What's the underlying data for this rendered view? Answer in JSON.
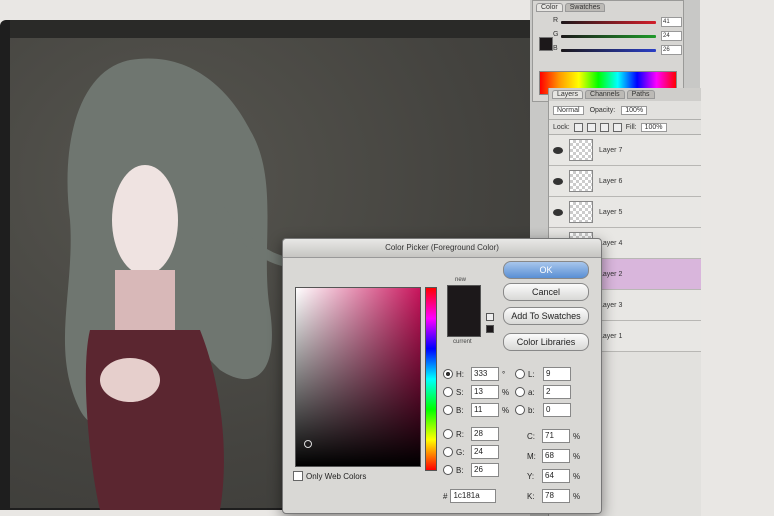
{
  "color_panel": {
    "tabs": [
      "Color",
      "Swatches"
    ],
    "sliders": [
      {
        "label": "R",
        "value": "41",
        "color": "#d21e2a"
      },
      {
        "label": "G",
        "value": "24",
        "color": "#1f9a2a"
      },
      {
        "label": "B",
        "value": "26",
        "color": "#2a3fc6"
      }
    ]
  },
  "layers_panel": {
    "tabs": [
      "Layers",
      "Channels",
      "Paths"
    ],
    "blend_mode": "Normal",
    "opacity_label": "Opacity:",
    "opacity_value": "100%",
    "lock_label": "Lock:",
    "fill_label": "Fill:",
    "fill_value": "100%",
    "layers": [
      {
        "name": "Layer 7",
        "selected": false
      },
      {
        "name": "Layer 6",
        "selected": false
      },
      {
        "name": "Layer 5",
        "selected": false
      },
      {
        "name": "Layer 4",
        "selected": false
      },
      {
        "name": "Layer 2",
        "selected": true
      },
      {
        "name": "Layer 3",
        "selected": false
      },
      {
        "name": "Layer 1",
        "selected": false
      }
    ]
  },
  "picker": {
    "title": "Color Picker (Foreground Color)",
    "new_label": "new",
    "current_label": "current",
    "buttons": {
      "ok": "OK",
      "cancel": "Cancel",
      "add_swatches": "Add To Swatches",
      "libraries": "Color Libraries"
    },
    "hsb": [
      {
        "label": "H:",
        "value": "333",
        "unit": "°",
        "selected": true
      },
      {
        "label": "S:",
        "value": "13",
        "unit": "%",
        "selected": false
      },
      {
        "label": "B:",
        "value": "11",
        "unit": "%",
        "selected": false
      }
    ],
    "rgb": [
      {
        "label": "R:",
        "value": "28",
        "unit": "",
        "selected": false
      },
      {
        "label": "G:",
        "value": "24",
        "unit": "",
        "selected": false
      },
      {
        "label": "B:",
        "value": "26",
        "unit": "",
        "selected": false
      }
    ],
    "lab": [
      {
        "label": "L:",
        "value": "9"
      },
      {
        "label": "a:",
        "value": "2"
      },
      {
        "label": "b:",
        "value": "0"
      }
    ],
    "cmyk": [
      {
        "label": "C:",
        "value": "71",
        "unit": "%"
      },
      {
        "label": "M:",
        "value": "68",
        "unit": "%"
      },
      {
        "label": "Y:",
        "value": "64",
        "unit": "%"
      },
      {
        "label": "K:",
        "value": "78",
        "unit": "%"
      }
    ],
    "only_web_colors": "Only Web Colors",
    "hex_label": "#",
    "hex_value": "1c181a",
    "swatch_color": "#1c181a"
  }
}
